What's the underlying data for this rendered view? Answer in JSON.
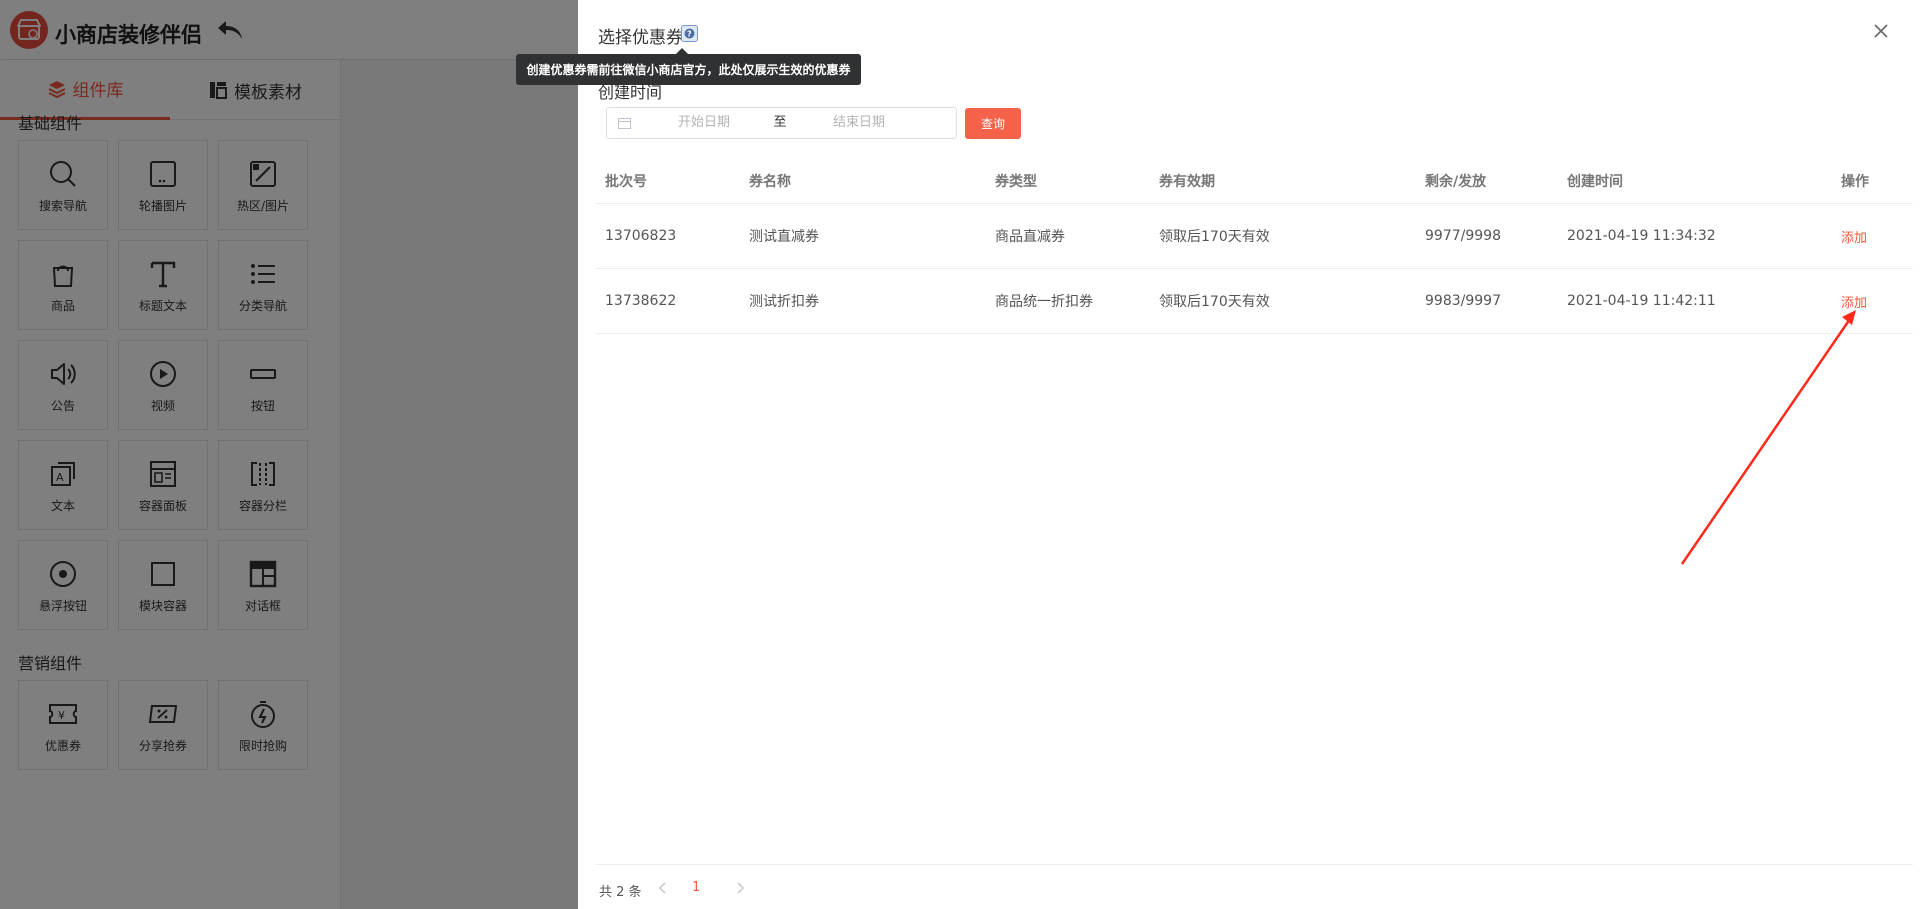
{
  "app": {
    "title": "小商店装修伴侣",
    "tabs": [
      {
        "label": "组件库",
        "icon": "layers-icon",
        "active": true
      },
      {
        "label": "模板素材",
        "icon": "template-icon",
        "active": false
      }
    ],
    "sections": [
      {
        "title": "基础组件",
        "items": [
          {
            "label": "搜索导航",
            "icon": "search-icon"
          },
          {
            "label": "轮播图片",
            "icon": "carousel-image-icon"
          },
          {
            "label": "热区/图片",
            "icon": "hotspot-image-icon"
          },
          {
            "label": "商品",
            "icon": "shopping-bag-icon"
          },
          {
            "label": "标题文本",
            "icon": "title-text-icon"
          },
          {
            "label": "分类导航",
            "icon": "list-icon"
          },
          {
            "label": "公告",
            "icon": "speaker-icon"
          },
          {
            "label": "视频",
            "icon": "play-icon"
          },
          {
            "label": "按钮",
            "icon": "button-icon"
          },
          {
            "label": "文本",
            "icon": "text-icon"
          },
          {
            "label": "容器面板",
            "icon": "container-panel-icon"
          },
          {
            "label": "容器分栏",
            "icon": "columns-icon"
          },
          {
            "label": "悬浮按钮",
            "icon": "floating-button-icon"
          },
          {
            "label": "模块容器",
            "icon": "square-icon"
          },
          {
            "label": "对话框",
            "icon": "dialog-icon"
          }
        ]
      },
      {
        "title": "营销组件",
        "items": [
          {
            "label": "优惠券",
            "icon": "coupon-icon"
          },
          {
            "label": "分享抢券",
            "icon": "share-coupon-icon"
          },
          {
            "label": "限时抢购",
            "icon": "stopwatch-icon"
          }
        ]
      }
    ]
  },
  "drawer": {
    "title": "选择优惠券",
    "tooltip": "创建优惠券需前往微信小商店官方，此处仅展示生效的优惠券",
    "filter": {
      "label": "创建时间",
      "start_placeholder": "开始日期",
      "separator": "至",
      "end_placeholder": "结束日期",
      "query_label": "查询"
    },
    "table": {
      "columns": [
        "批次号",
        "券名称",
        "券类型",
        "券有效期",
        "剩余/发放",
        "创建时间",
        "操作"
      ],
      "rows": [
        {
          "batch": "13706823",
          "name": "测试直减券",
          "type": "商品直减券",
          "validity": "领取后170天有效",
          "remain": "9977/9998",
          "created": "2021-04-19 11:34:32",
          "action": "添加"
        },
        {
          "batch": "13738622",
          "name": "测试折扣券",
          "type": "商品统一折扣券",
          "validity": "领取后170天有效",
          "remain": "9983/9997",
          "created": "2021-04-19 11:42:11",
          "action": "添加"
        }
      ]
    },
    "pagination": {
      "total": "共 2 条",
      "current_page": "1"
    }
  },
  "colors": {
    "accent": "#f0573d",
    "annotation_arrow": "#ff2a1a",
    "overlay": "rgba(0,0,0,0.5)"
  }
}
